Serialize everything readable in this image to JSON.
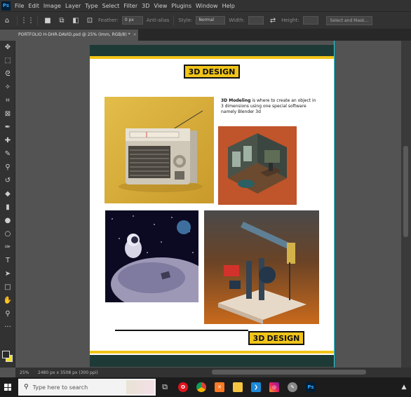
{
  "app": {
    "logo": "Ps"
  },
  "menu": [
    "File",
    "Edit",
    "Image",
    "Layer",
    "Type",
    "Select",
    "Filter",
    "3D",
    "View",
    "Plugins",
    "Window",
    "Help"
  ],
  "options_bar": {
    "feather_label": "Feather:",
    "feather_value": "0 px",
    "antialias_label": "Anti-alias",
    "style_label": "Style:",
    "style_value": "Normal",
    "width_label": "Width:",
    "height_label": "Height:",
    "select_mask_label": "Select and Mask..."
  },
  "document_tab": {
    "title": "PORTFOLIO H-DHR-DAVID.psd @ 25% (Imm, RGB/8) *",
    "close": "×"
  },
  "status": {
    "zoom": "25%",
    "info": "2480 px x 3508 px (300 ppi)"
  },
  "page": {
    "logo_top": {
      "prefix": "3D",
      "word": "DESIGN"
    },
    "logo_bottom": {
      "prefix": "3D",
      "word": "DESIGN"
    },
    "description_bold": "3D Modeling",
    "description_rest": " is where to create an object in 3 dimensions using one special software namely Blender 3d"
  },
  "taskbar": {
    "search_placeholder": "Type here to search",
    "icons": [
      "task-view",
      "opera",
      "chrome",
      "xampp",
      "file-explorer",
      "vscode",
      "instagram",
      "inkscape",
      "photoshop"
    ]
  },
  "colors": {
    "gold": "#f0c419",
    "doc_border": "#1e3a36",
    "guide": "#19d3e3",
    "ps_bg": "#535353"
  }
}
